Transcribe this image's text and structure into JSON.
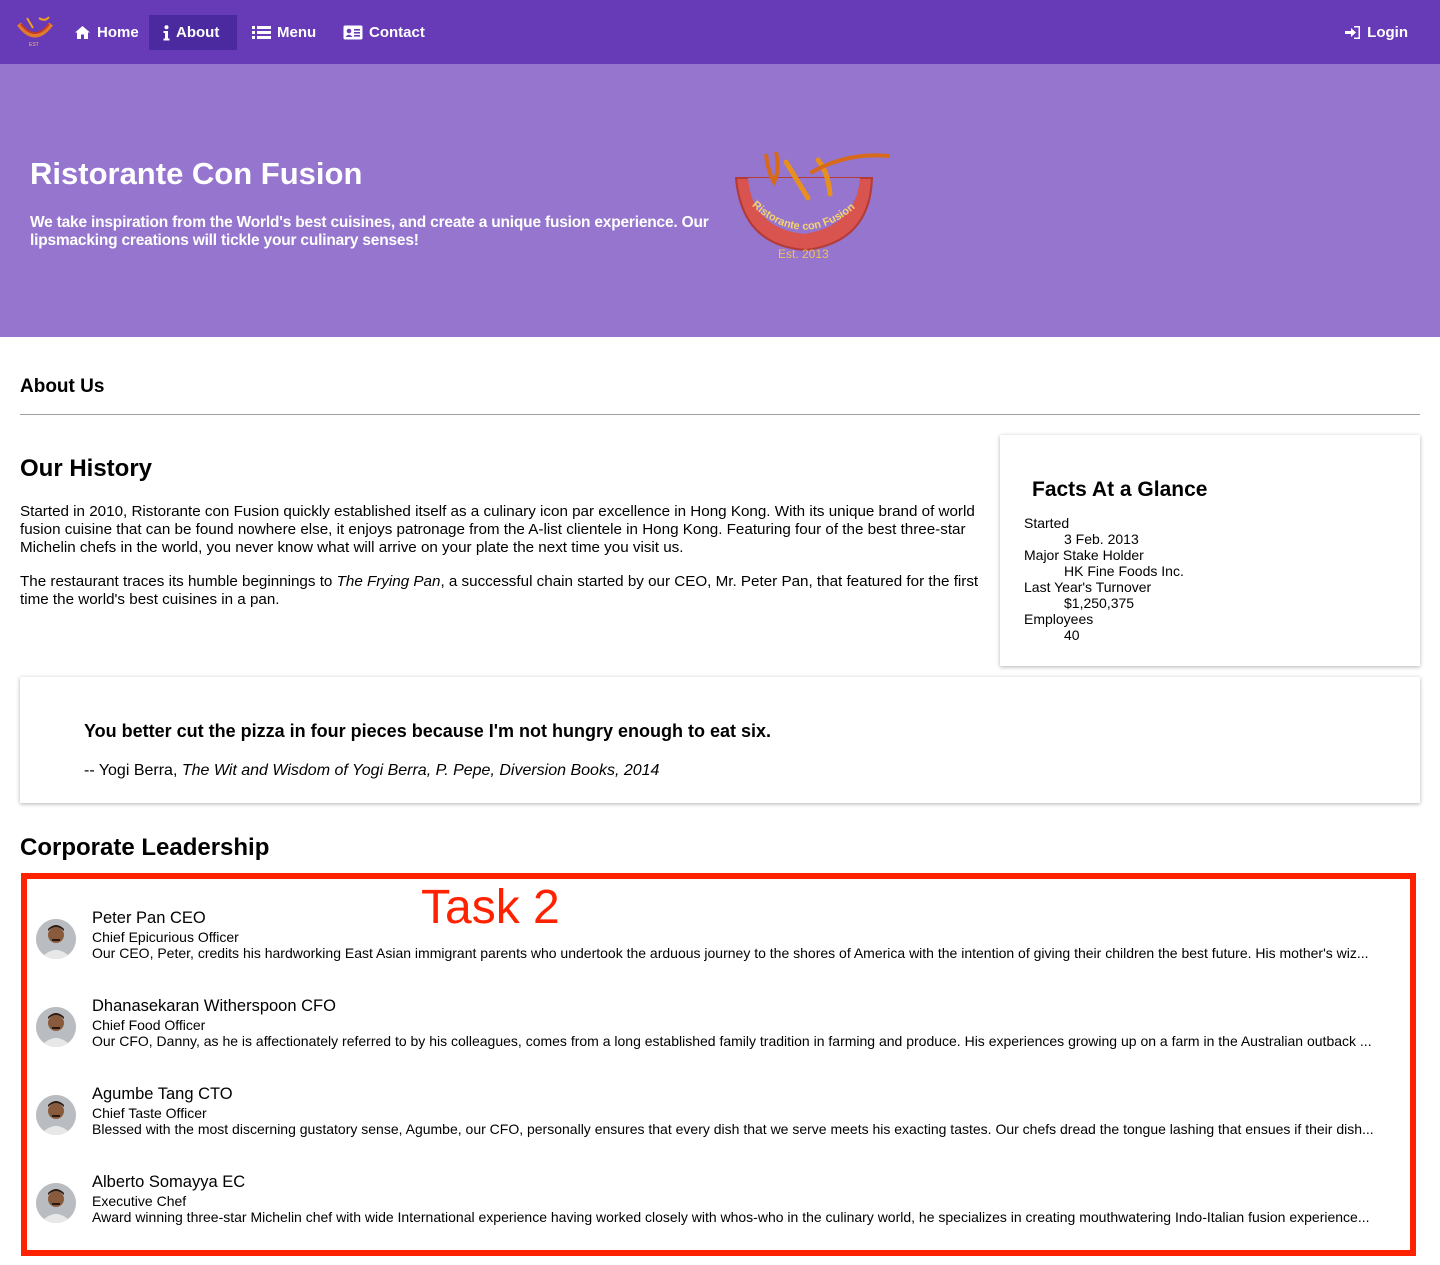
{
  "nav": {
    "items": [
      {
        "label": "Home",
        "icon": "home-icon"
      },
      {
        "label": "About",
        "icon": "info-icon",
        "active": true
      },
      {
        "label": "Menu",
        "icon": "list-icon"
      },
      {
        "label": "Contact",
        "icon": "address-card-icon"
      }
    ],
    "login": {
      "label": "Login",
      "icon": "sign-in-icon"
    }
  },
  "jumbotron": {
    "title": "Ristorante Con Fusion",
    "text": "We take inspiration from the World's best cuisines, and create a unique fusion experience. Our lipsmacking creations will tickle your culinary senses!",
    "logo": {
      "arc_text": "Ristorante con Fusion",
      "est": "Est. 2013"
    }
  },
  "about": {
    "heading": "About Us",
    "history_title": "Our History",
    "history_p1": "Started in 2010, Ristorante con Fusion quickly established itself as a culinary icon par excellence in Hong Kong. With its unique brand of world fusion cuisine that can be found nowhere else, it enjoys patronage from the A-list clientele in Hong Kong. Featuring four of the best three-star Michelin chefs in the world, you never know what will arrive on your plate the next time you visit us.",
    "history_p2_before": "The restaurant traces its humble beginnings to ",
    "history_p2_italic": "The Frying Pan",
    "history_p2_after": ", a successful chain started by our CEO, Mr. Peter Pan, that featured for the first time the world's best cuisines in a pan."
  },
  "facts": {
    "title": "Facts At a Glance",
    "items": [
      {
        "term": "Started",
        "value": "3 Feb. 2013"
      },
      {
        "term": "Major Stake Holder",
        "value": "HK Fine Foods Inc."
      },
      {
        "term": "Last Year's Turnover",
        "value": "$1,250,375"
      },
      {
        "term": "Employees",
        "value": "40"
      }
    ]
  },
  "quote": {
    "text": "You better cut the pizza in four pieces because I'm not hungry enough to eat six.",
    "prefix": "-- Yogi Berra, ",
    "source": "The Wit and Wisdom of Yogi Berra, P. Pepe, Diversion Books, 2014"
  },
  "leadership": {
    "title": "Corporate Leadership",
    "annotation": "Task 2",
    "annotation_color": "#ff2200",
    "leaders": [
      {
        "name": "Peter Pan CEO",
        "role": "Chief Epicurious Officer",
        "description": "Our CEO, Peter, credits his hardworking East Asian immigrant parents who undertook the arduous journey to the shores of America with the intention of giving their children the best future. His mother's wiz..."
      },
      {
        "name": "Dhanasekaran Witherspoon CFO",
        "role": "Chief Food Officer",
        "description": "Our CFO, Danny, as he is affectionately referred to by his colleagues, comes from a long established family tradition in farming and produce. His experiences growing up on a farm in the Australian outback ..."
      },
      {
        "name": "Agumbe Tang CTO",
        "role": "Chief Taste Officer",
        "description": "Blessed with the most discerning gustatory sense, Agumbe, our CFO, personally ensures that every dish that we serve meets his exacting tastes. Our chefs dread the tongue lashing that ensues if their dish..."
      },
      {
        "name": "Alberto Somayya EC",
        "role": "Executive Chef",
        "description": "Award winning three-star Michelin chef with wide International experience having worked closely with whos-who in the culinary world, he specializes in creating mouthwatering Indo-Italian fusion experience..."
      }
    ]
  },
  "colors": {
    "navbar": "#673ab7",
    "nav_active": "#4a2a9e",
    "jumbotron": "#9575cd",
    "annotation": "#ff2200"
  }
}
